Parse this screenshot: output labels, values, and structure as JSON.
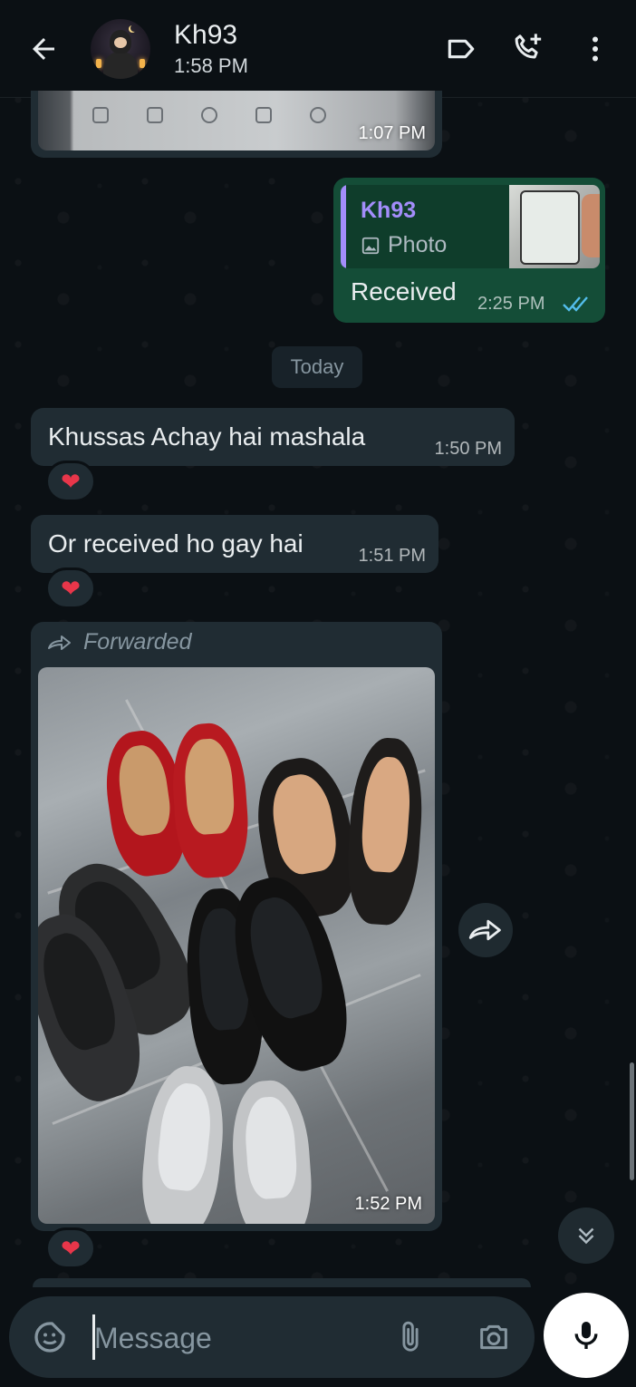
{
  "header": {
    "contact_name": "Kh93",
    "last_seen": "1:58 PM",
    "icons": [
      "back-arrow-icon",
      "label-icon",
      "add-call-icon",
      "more-vertical-icon"
    ]
  },
  "messages": {
    "partial_image": {
      "time": "1:07 PM"
    },
    "outgoing_reply": {
      "quoted_name": "Kh93",
      "quoted_type": "Photo",
      "text": "Received",
      "time": "2:25 PM",
      "status_icon": "double-check-read-icon"
    },
    "date_separator": "Today",
    "incoming_1": {
      "text": "Khussas Achay hai mashala",
      "time": "1:50 PM",
      "reaction": "❤"
    },
    "incoming_2": {
      "text": "Or received ho gay hai",
      "time": "1:51 PM",
      "reaction": "❤"
    },
    "forwarded_photo": {
      "label": "Forwarded",
      "time": "1:52 PM",
      "reaction": "❤"
    }
  },
  "composer": {
    "placeholder": "Message",
    "icons": [
      "sticker-icon",
      "paperclip-icon",
      "camera-icon",
      "microphone-icon"
    ]
  },
  "colors": {
    "background": "#0b1014",
    "incoming_bubble": "#202c33",
    "outgoing_bubble": "#144d37",
    "read_tick": "#53bdeb",
    "quote_accent": "#a38dfa",
    "heart": "#e8364a"
  }
}
